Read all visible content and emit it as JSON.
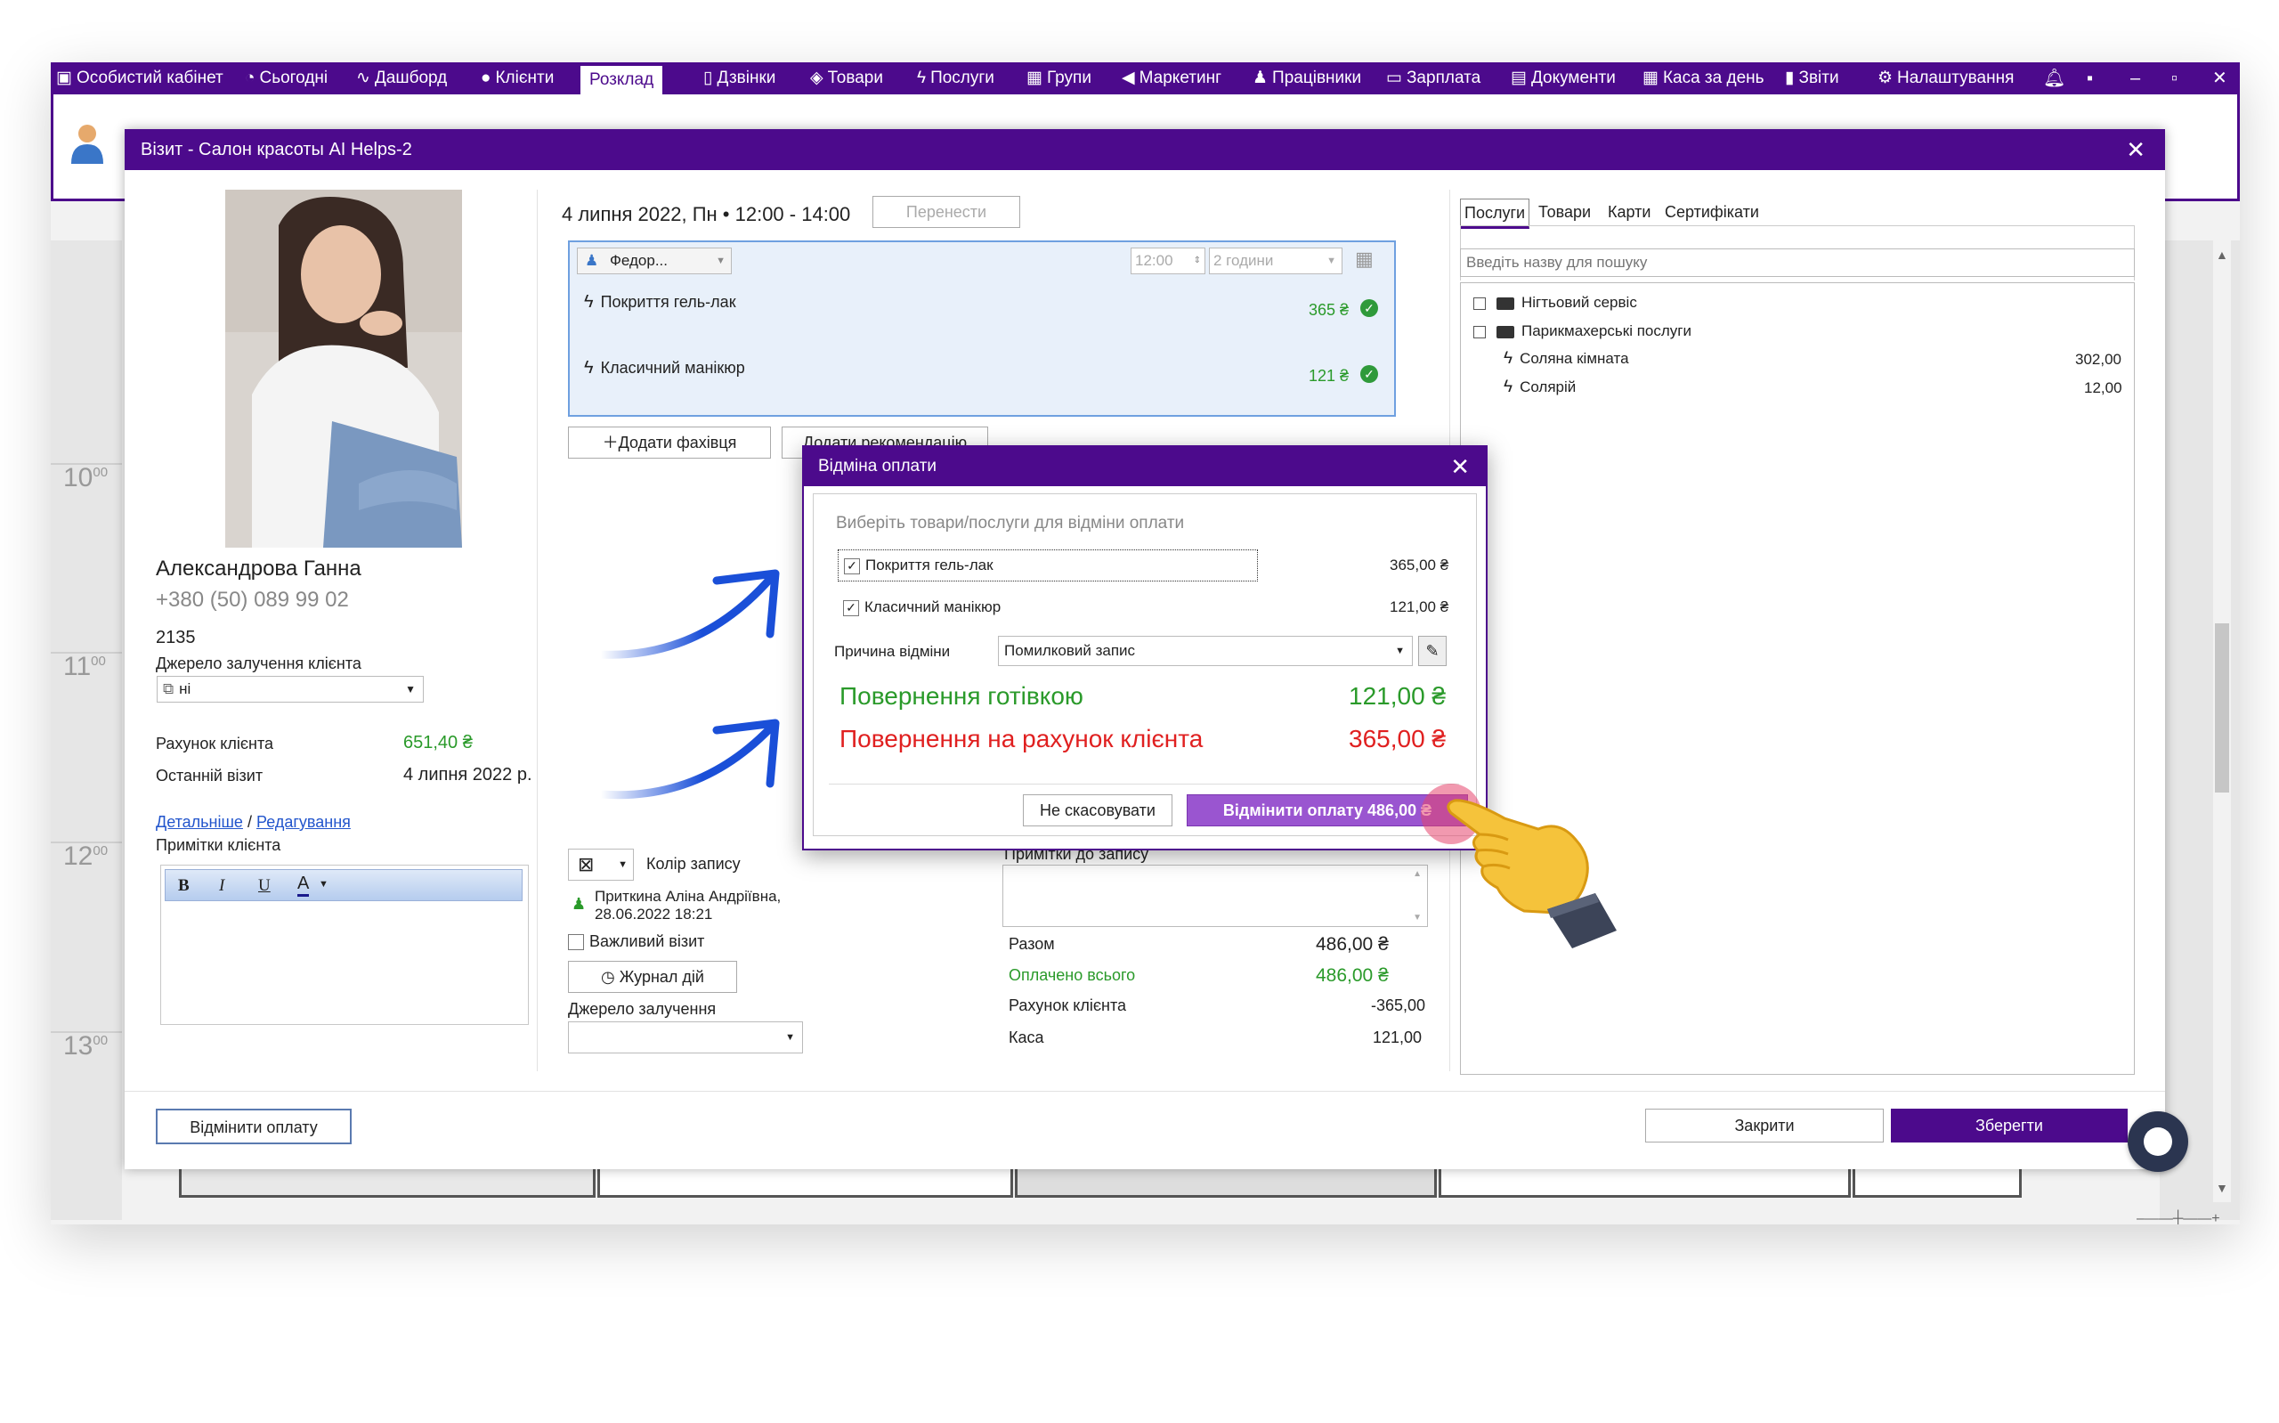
{
  "menubar": {
    "items": [
      {
        "label": "Особистий кабінет",
        "icon": "briefcase-icon"
      },
      {
        "label": "Сьогодні",
        "icon": "clock-icon"
      },
      {
        "label": "Дашборд",
        "icon": "pulse-icon"
      },
      {
        "label": "Клієнти",
        "icon": "user-circle-icon"
      },
      {
        "label": "Розклад",
        "icon": "",
        "active": true
      },
      {
        "label": "Дзвінки",
        "icon": "phone-icon"
      },
      {
        "label": "Товари",
        "icon": "box-icon"
      },
      {
        "label": "Послуги",
        "icon": "lightning-icon"
      },
      {
        "label": "Групи",
        "icon": "group-icon"
      },
      {
        "label": "Маркетинг",
        "icon": "megaphone-icon"
      },
      {
        "label": "Працівники",
        "icon": "person-icon"
      },
      {
        "label": "Зарплата",
        "icon": "money-icon"
      },
      {
        "label": "Документи",
        "icon": "document-icon"
      },
      {
        "label": "Каса за день",
        "icon": "calculator-icon"
      },
      {
        "label": "Звіти",
        "icon": "bar-chart-icon"
      },
      {
        "label": "Налаштування",
        "icon": "gear-icon"
      }
    ]
  },
  "schedule": {
    "hours": [
      "10",
      "11",
      "12",
      "13"
    ],
    "minutes": "00"
  },
  "visit_dialog": {
    "title": "Візит - Салон красоты AI Helps-2",
    "client": {
      "name": "Александрова Ганна",
      "phone": "+380 (50) 089 99 02",
      "id": "2135",
      "source_label": "Джерело залучення клієнта",
      "source_value": "ні",
      "account_label": "Рахунок клієнта",
      "account_value": "651,40 ₴",
      "last_visit_label": "Останній візит",
      "last_visit_value": "4 липня 2022 р.",
      "more_link": "Детальніше",
      "separator": "/",
      "edit_link": "Редагування",
      "notes_label": "Примітки клієнта"
    },
    "date_time": "4 липня 2022, Пн • 12:00 - 14:00",
    "move_button": "Перенести",
    "specialist": "Федор...",
    "start_time": "12:00",
    "duration": "2 години",
    "services": [
      {
        "name": "Покриття гель-лак",
        "price": "365 ₴"
      },
      {
        "name": "Класичний манікюр",
        "price": "121 ₴"
      }
    ],
    "add_specialist": "Додати фахівця",
    "add_recommendation": "Додати рекомендацію",
    "record_color_label": "Колір запису",
    "created_by": "Приткина Аліна Андріївна,",
    "created_at": "28.06.2022 18:21",
    "important_label": "Важливий візит",
    "log_button": "Журнал дій",
    "source_label": "Джерело залучення",
    "record_notes_label": "Примітки до запису",
    "totals": {
      "total_label": "Разом",
      "total_value": "486,00 ₴",
      "paid_label": "Оплачено всього",
      "paid_value": "486,00 ₴",
      "account_label": "Рахунок клієнта",
      "account_value": "-365,00",
      "cash_label": "Каса",
      "cash_value": "121,00"
    },
    "tabs": [
      "Послуги",
      "Товари",
      "Карти",
      "Сертифікати"
    ],
    "search_placeholder": "Введіть назву для пошуку",
    "tree": [
      {
        "name": "Нігтьовий сервіс",
        "type": "folder"
      },
      {
        "name": "Парикмахерські послуги",
        "type": "folder"
      },
      {
        "name": "Соляна кімната",
        "type": "service",
        "price": "302,00"
      },
      {
        "name": "Солярій",
        "type": "service",
        "price": "12,00"
      }
    ],
    "cancel_payment_button": "Відмінити оплату",
    "close_button": "Закрити",
    "save_button": "Зберегти"
  },
  "cancel_modal": {
    "title": "Відміна оплати",
    "instruction": "Виберіть товари/послуги для відміни оплати",
    "items": [
      {
        "name": "Покриття гель-лак",
        "amount": "365,00 ₴",
        "checked": true
      },
      {
        "name": "Класичний манікюр",
        "amount": "121,00 ₴",
        "checked": true
      }
    ],
    "reason_label": "Причина відміни",
    "reason_value": "Помилковий запис",
    "cash_refund_label": "Повернення готівкою",
    "cash_refund_value": "121,00 ₴",
    "account_refund_label": "Повернення на рахунок клієнта",
    "account_refund_value": "365,00 ₴",
    "dont_cancel_button": "Не скасовувати",
    "confirm_button": "Відмінити оплату 486,00 ₴"
  },
  "colors": {
    "brand": "#4c0a8c",
    "green": "#2a9a2a",
    "red": "#e02020",
    "arrow": "#1a4fd8"
  }
}
